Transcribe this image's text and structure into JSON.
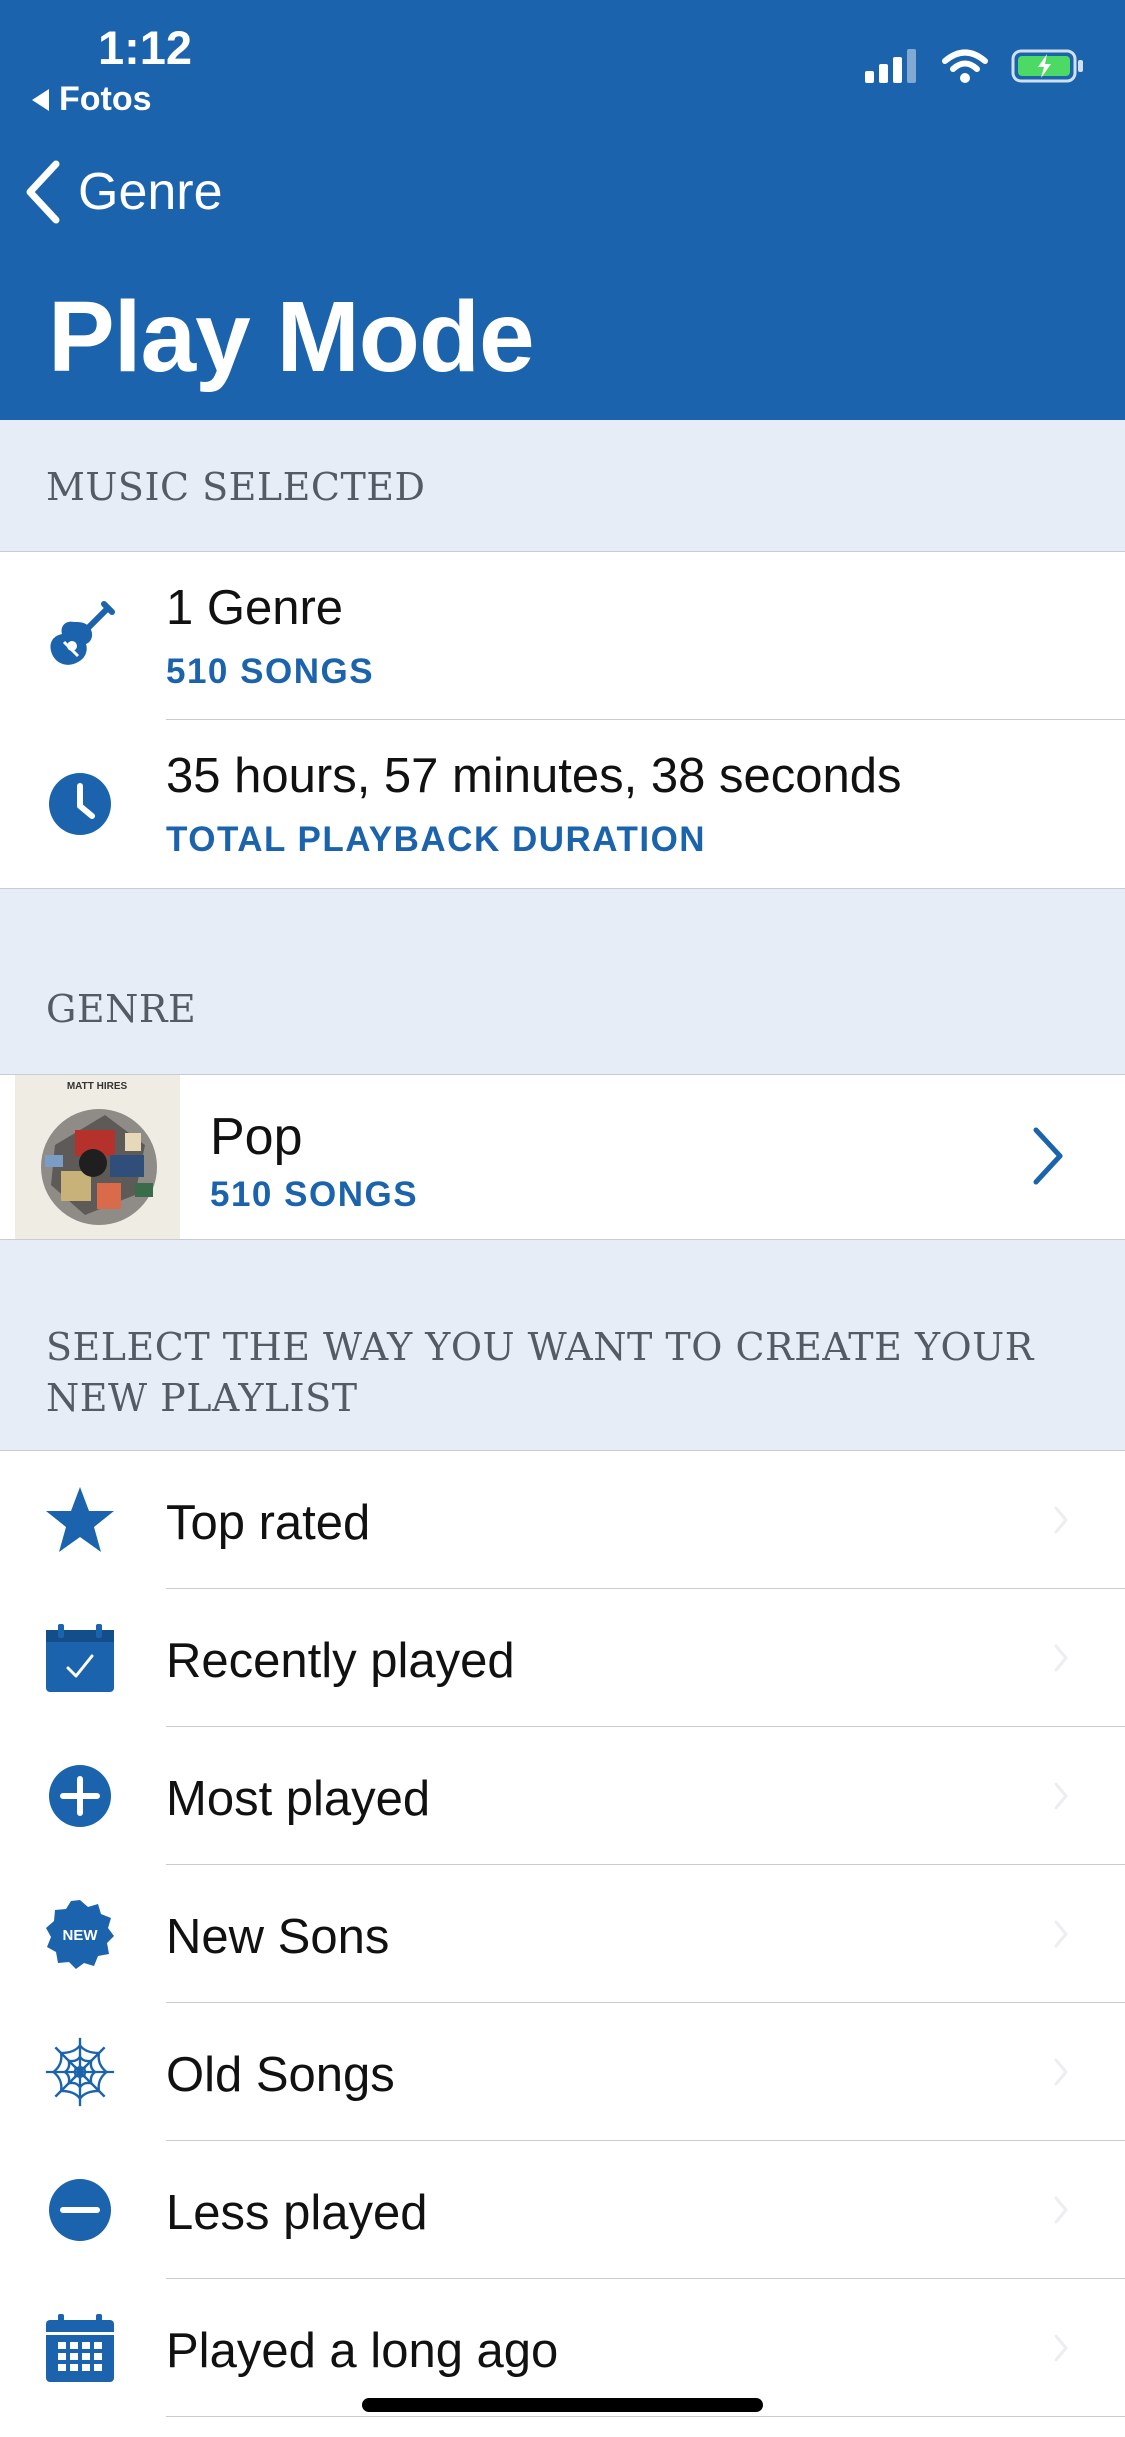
{
  "status_bar": {
    "time": "1:12",
    "back_app": "Fotos"
  },
  "nav": {
    "back_label": "Genre",
    "title": "Play Mode"
  },
  "music_selected": {
    "header": "MUSIC SELECTED",
    "items": [
      {
        "title": "1 Genre",
        "subtitle": "510 SONGS",
        "icon": "guitar-icon"
      },
      {
        "title": "35 hours, 57 minutes, 38 seconds",
        "subtitle": "TOTAL PLAYBACK DURATION",
        "icon": "clock-icon"
      }
    ]
  },
  "genre": {
    "header": "GENRE",
    "item": {
      "title": "Pop",
      "subtitle": "510 SONGS",
      "art_text": "MATT HIRES"
    }
  },
  "playlist": {
    "header": "SELECT THE WAY YOU WANT TO CREATE YOUR NEW PLAYLIST",
    "header_line1": "SELECT THE WAY YOU WANT TO CREATE YOUR",
    "header_line2": "NEW PLAYLIST",
    "options": [
      {
        "label": "Top rated",
        "icon": "star-icon"
      },
      {
        "label": "Recently played",
        "icon": "calendar-check-icon"
      },
      {
        "label": "Most played",
        "icon": "plus-circle-icon"
      },
      {
        "label": "New Sons",
        "icon": "new-badge-icon",
        "badge_text": "NEW"
      },
      {
        "label": "Old Songs",
        "icon": "cobweb-icon"
      },
      {
        "label": "Less played",
        "icon": "minus-circle-icon"
      },
      {
        "label": "Played a long ago",
        "icon": "calendar-grid-icon"
      }
    ]
  },
  "colors": {
    "brand": "#1b63ac",
    "background": "#e6edf7",
    "separator": "#c8ccd2"
  }
}
